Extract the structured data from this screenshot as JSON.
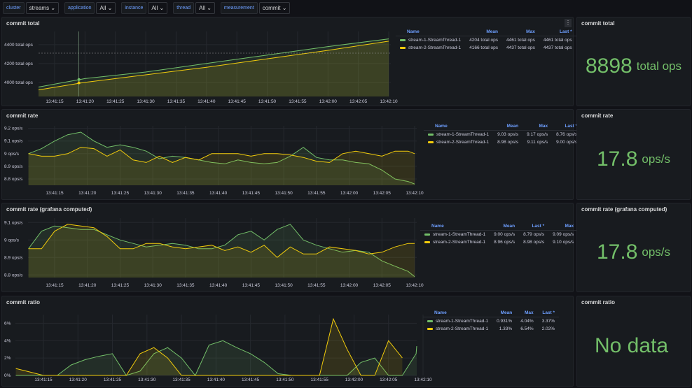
{
  "variables": [
    {
      "label": "cluster",
      "value": "streams",
      "dropdown": true
    },
    {
      "label": "application",
      "value": "All",
      "dropdown": true
    },
    {
      "label": "instance",
      "value": "All",
      "dropdown": true
    },
    {
      "label": "thread",
      "value": "All",
      "dropdown": true
    },
    {
      "label": "measurement",
      "value": "commit",
      "dropdown": true
    }
  ],
  "colors": {
    "green": "#73bf69",
    "yellow": "#f2cc0c",
    "accent": "#6e9fff"
  },
  "panels": [
    {
      "title": "commit total",
      "legend": {
        "columns": [
          "Name",
          "Mean",
          "Max",
          "Last *"
        ],
        "rows": [
          [
            "stream-1-StreamThread-1",
            "4204 total ops",
            "4461 total ops",
            "4461 total ops"
          ],
          [
            "stream-2-StreamThread-1",
            "4166 total ops",
            "4437 total ops",
            "4437 total ops"
          ]
        ]
      },
      "stat": {
        "title": "commit total",
        "value": "8898",
        "unit": "total ops"
      }
    },
    {
      "title": "commit rate",
      "legend": {
        "columns": [
          "Name",
          "Mean",
          "Max",
          "Last *"
        ],
        "rows": [
          [
            "stream-1-StreamThread-1",
            "9.03 ops/s",
            "9.17 ops/s",
            "8.76 ops/s"
          ],
          [
            "stream-2-StreamThread-1",
            "8.98 ops/s",
            "9.11 ops/s",
            "9.00 ops/s"
          ]
        ]
      },
      "stat": {
        "title": "commit rate",
        "value": "17.8",
        "unit": "ops/s"
      }
    },
    {
      "title": "commit rate (grafana computed)",
      "legend": {
        "columns": [
          "Name",
          "Mean",
          "Last *",
          "Max"
        ],
        "rows": [
          [
            "stream-1-StreamThread-1",
            "9.00 ops/s",
            "8.79 ops/s",
            "9.09 ops/s"
          ],
          [
            "stream-2-StreamThread-1",
            "8.96 ops/s",
            "8.98 ops/s",
            "9.10 ops/s"
          ]
        ]
      },
      "stat": {
        "title": "commit rate (grafana computed)",
        "value": "17.8",
        "unit": "ops/s"
      }
    },
    {
      "title": "commit ratio",
      "legend": {
        "columns": [
          "Name",
          "Mean",
          "Max",
          "Last *"
        ],
        "rows": [
          [
            "stream-1-StreamThread-1",
            "0.931%",
            "4.04%",
            "3.37%"
          ],
          [
            "stream-2-StreamThread-1",
            "1.33%",
            "6.54%",
            "2.02%"
          ]
        ]
      },
      "stat": {
        "title": "commit ratio",
        "value": "No data",
        "unit": ""
      }
    }
  ],
  "chart_data": [
    {
      "type": "line",
      "title": "commit total",
      "x": [
        "13:41:12",
        "13:41:20",
        "13:41:30",
        "13:41:40",
        "13:41:50",
        "13:42:00",
        "13:42:10"
      ],
      "xticks": [
        "13:41:15",
        "13:41:20",
        "13:41:25",
        "13:41:30",
        "13:41:35",
        "13:41:40",
        "13:41:45",
        "13:41:50",
        "13:41:55",
        "13:42:00",
        "13:42:05",
        "13:42:10"
      ],
      "yticks": [
        "4000 total ops",
        "4200 total ops",
        "4400 total ops"
      ],
      "ytick_values": [
        4000,
        4200,
        4400
      ],
      "ylim": [
        3850,
        4540
      ],
      "series": [
        {
          "name": "stream-1-StreamThread-1",
          "values": [
            3950,
            4040,
            4110,
            4200,
            4290,
            4380,
            4461
          ]
        },
        {
          "name": "stream-2-StreamThread-1",
          "values": [
            3920,
            4000,
            4080,
            4160,
            4250,
            4340,
            4437
          ]
        }
      ],
      "crosshair_time": "13:41:19"
    },
    {
      "type": "line",
      "title": "commit rate",
      "x": [
        "13:41:11",
        "13:41:13",
        "13:41:15",
        "13:41:17",
        "13:41:19",
        "13:41:21",
        "13:41:23",
        "13:41:25",
        "13:41:27",
        "13:41:29",
        "13:41:31",
        "13:41:33",
        "13:41:35",
        "13:41:37",
        "13:41:39",
        "13:41:41",
        "13:41:43",
        "13:41:45",
        "13:41:47",
        "13:41:49",
        "13:41:51",
        "13:41:53",
        "13:41:55",
        "13:41:57",
        "13:41:59",
        "13:42:01",
        "13:42:03",
        "13:42:05",
        "13:42:07",
        "13:42:09",
        "13:42:10"
      ],
      "xticks": [
        "13:41:15",
        "13:41:20",
        "13:41:25",
        "13:41:30",
        "13:41:35",
        "13:41:40",
        "13:41:45",
        "13:41:50",
        "13:41:55",
        "13:42:00",
        "13:42:05",
        "13:42:10"
      ],
      "yticks": [
        "8.8 ops/s",
        "8.9 ops/s",
        "9 ops/s",
        "9.1 ops/s",
        "9.2 ops/s"
      ],
      "ytick_values": [
        8.8,
        8.9,
        9,
        9.1,
        9.2
      ],
      "ylim": [
        8.75,
        9.22
      ],
      "series": [
        {
          "name": "stream-1-StreamThread-1",
          "values": [
            9.0,
            9.04,
            9.1,
            9.15,
            9.17,
            9.1,
            9.05,
            9.07,
            9.05,
            9.02,
            8.96,
            8.98,
            8.97,
            8.95,
            8.93,
            8.92,
            8.95,
            8.93,
            8.92,
            8.93,
            8.98,
            9.05,
            8.97,
            8.95,
            8.95,
            8.93,
            8.92,
            8.87,
            8.8,
            8.78,
            8.76
          ]
        },
        {
          "name": "stream-2-StreamThread-1",
          "values": [
            9.0,
            8.98,
            8.98,
            9.0,
            9.05,
            9.04,
            8.98,
            9.03,
            8.95,
            8.93,
            8.98,
            8.93,
            8.97,
            8.95,
            9.0,
            9.0,
            9.0,
            8.98,
            9.0,
            9.0,
            8.99,
            8.97,
            8.94,
            8.93,
            9.0,
            9.02,
            9.0,
            8.98,
            9.02,
            9.02,
            9.0
          ]
        }
      ]
    },
    {
      "type": "line",
      "title": "commit rate (grafana computed)",
      "x": [
        "13:41:11",
        "13:41:13",
        "13:41:15",
        "13:41:17",
        "13:41:19",
        "13:41:21",
        "13:41:23",
        "13:41:25",
        "13:41:27",
        "13:41:29",
        "13:41:31",
        "13:41:33",
        "13:41:35",
        "13:41:37",
        "13:41:39",
        "13:41:41",
        "13:41:43",
        "13:41:45",
        "13:41:47",
        "13:41:49",
        "13:41:51",
        "13:41:53",
        "13:41:55",
        "13:41:57",
        "13:41:59",
        "13:42:01",
        "13:42:03",
        "13:42:05",
        "13:42:07",
        "13:42:09",
        "13:42:10"
      ],
      "xticks": [
        "13:41:15",
        "13:41:20",
        "13:41:25",
        "13:41:30",
        "13:41:35",
        "13:41:40",
        "13:41:45",
        "13:41:50",
        "13:41:55",
        "13:42:00",
        "13:42:05",
        "13:42:10"
      ],
      "yticks": [
        "8.8 ops/s",
        "8.9 ops/s",
        "9 ops/s",
        "9.1 ops/s"
      ],
      "ytick_values": [
        8.8,
        8.9,
        9,
        9.1
      ],
      "ylim": [
        8.785,
        9.125
      ],
      "series": [
        {
          "name": "stream-1-StreamThread-1",
          "values": [
            8.95,
            9.05,
            9.08,
            9.07,
            9.06,
            9.06,
            9.03,
            9.0,
            8.98,
            8.96,
            8.97,
            8.98,
            8.97,
            8.95,
            8.95,
            8.97,
            9.03,
            9.05,
            9.0,
            9.06,
            9.09,
            9.0,
            8.97,
            8.95,
            8.93,
            8.94,
            8.93,
            8.88,
            8.85,
            8.82,
            8.79
          ]
        },
        {
          "name": "stream-2-StreamThread-1",
          "values": [
            8.95,
            8.95,
            9.05,
            9.09,
            9.08,
            9.07,
            9.02,
            8.95,
            8.95,
            8.98,
            8.98,
            8.96,
            8.95,
            8.96,
            8.97,
            8.94,
            8.96,
            8.93,
            8.97,
            8.9,
            8.96,
            8.92,
            8.92,
            8.96,
            8.95,
            8.94,
            8.92,
            8.93,
            8.96,
            8.98,
            8.98
          ]
        }
      ]
    },
    {
      "type": "line",
      "title": "commit ratio",
      "x": [
        "13:41:11",
        "13:41:13",
        "13:41:15",
        "13:41:17",
        "13:41:19",
        "13:41:21",
        "13:41:23",
        "13:41:25",
        "13:41:27",
        "13:41:29",
        "13:41:31",
        "13:41:33",
        "13:41:35",
        "13:41:37",
        "13:41:39",
        "13:41:41",
        "13:41:43",
        "13:41:45",
        "13:41:47",
        "13:41:49",
        "13:41:51",
        "13:41:53",
        "13:41:55",
        "13:41:57",
        "13:41:59",
        "13:42:01",
        "13:42:03",
        "13:42:05",
        "13:42:07",
        "13:42:09",
        "13:42:10"
      ],
      "xticks": [
        "13:41:15",
        "13:41:20",
        "13:41:25",
        "13:41:30",
        "13:41:35",
        "13:41:40",
        "13:41:45",
        "13:41:50",
        "13:41:55",
        "13:42:00",
        "13:42:05",
        "13:42:10"
      ],
      "yticks": [
        "0%",
        "2%",
        "4%",
        "6%"
      ],
      "ytick_values": [
        0,
        2,
        4,
        6
      ],
      "ylim": [
        0,
        7
      ],
      "series": [
        {
          "name": "stream-1-StreamThread-1",
          "values": [
            0,
            0,
            0,
            0,
            1.2,
            1.8,
            2.2,
            2.5,
            0,
            0.5,
            2.5,
            3.2,
            2,
            0,
            3.5,
            4,
            3.2,
            2.5,
            1.5,
            0.2,
            0,
            0,
            0,
            0,
            0,
            1.5,
            2,
            0,
            0,
            2.5,
            3.37
          ]
        },
        {
          "name": "stream-2-StreamThread-1",
          "values": [
            0.8,
            0.4,
            0,
            0,
            0,
            0,
            0,
            0,
            0,
            2.5,
            3.2,
            2,
            0,
            0,
            0,
            0,
            0,
            0,
            0,
            0,
            0,
            0,
            0,
            6.5,
            3,
            0,
            0,
            4,
            2.02,
            null,
            null
          ]
        }
      ]
    }
  ]
}
